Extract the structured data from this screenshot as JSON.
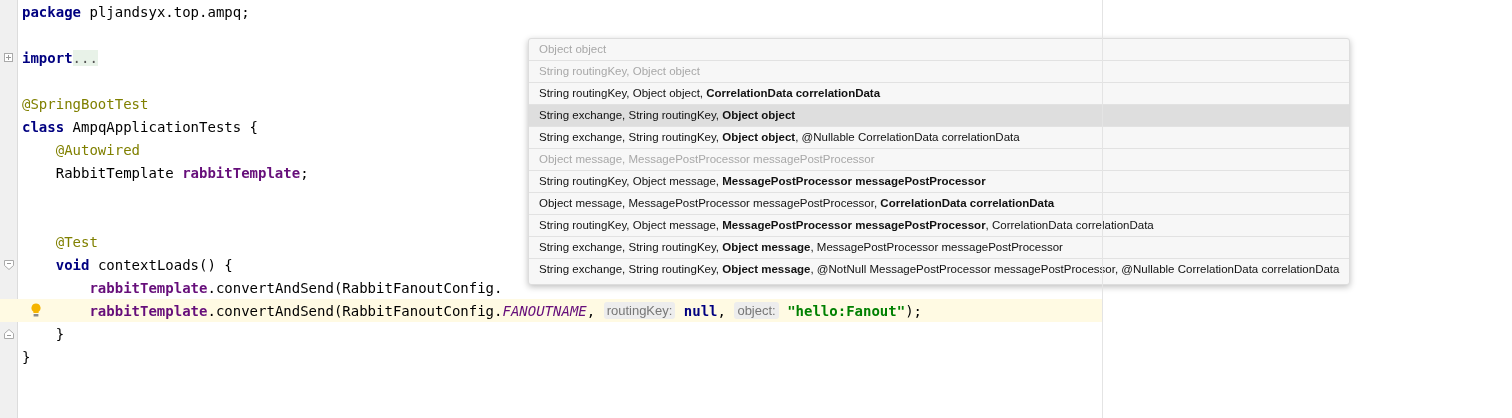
{
  "editor": {
    "lines": [
      {
        "current": false,
        "tokens": [
          {
            "kind": "keyword",
            "text": "package"
          },
          {
            "kind": "plain",
            "text": " pljandsyx.top.ampq;"
          }
        ]
      },
      {
        "current": false
      },
      {
        "current": false,
        "gutter": {
          "kind": "fold-plus"
        },
        "tokens": [
          {
            "kind": "keyword",
            "text": "import"
          },
          {
            "kind": "folded",
            "text": "..."
          }
        ]
      },
      {
        "current": false
      },
      {
        "current": false,
        "tokens": [
          {
            "kind": "annotation",
            "text": "@SpringBootTest"
          }
        ]
      },
      {
        "current": false,
        "tokens": [
          {
            "kind": "keyword",
            "text": "class"
          },
          {
            "kind": "plain",
            "text": " AmpqApplicationTests {"
          }
        ]
      },
      {
        "current": false,
        "tokens": [
          {
            "kind": "annotation",
            "text": "    @Autowired"
          }
        ]
      },
      {
        "current": false,
        "tokens": [
          {
            "kind": "plain",
            "text": "    RabbitTemplate "
          },
          {
            "kind": "field",
            "text": "rabbitTemplate"
          },
          {
            "kind": "plain",
            "text": ";"
          }
        ]
      },
      {
        "current": false
      },
      {
        "current": false
      },
      {
        "current": false,
        "tokens": [
          {
            "kind": "annotation",
            "text": "    @Test"
          }
        ]
      },
      {
        "current": false,
        "gutter": {
          "kind": "fold-minus"
        },
        "tokens": [
          {
            "kind": "keyword",
            "text": "    void"
          },
          {
            "kind": "plain",
            "text": " contextLoads() {"
          }
        ]
      },
      {
        "current": false,
        "tokens": [
          {
            "kind": "field",
            "text": "        rabbitTemplate"
          },
          {
            "kind": "plain",
            "text": ".convertAndSend(RabbitFanoutConfig."
          }
        ]
      },
      {
        "current": true,
        "gutter": {
          "kind": "bulb"
        },
        "tokens": [
          {
            "kind": "field",
            "text": "        rabbitTemplate"
          },
          {
            "kind": "plain",
            "text": ".convertAndSend(RabbitFanoutConfig."
          },
          {
            "kind": "static-field",
            "text": "FANOUTNAME"
          },
          {
            "kind": "plain",
            "text": ", "
          },
          {
            "kind": "hint",
            "text": "routingKey:"
          },
          {
            "kind": "keyword",
            "text": " null"
          },
          {
            "kind": "plain",
            "text": ", "
          },
          {
            "kind": "hint",
            "text": "object:"
          },
          {
            "kind": "string",
            "text": " \"hello:Fanout\""
          },
          {
            "kind": "plain",
            "text": ");"
          }
        ]
      },
      {
        "current": false,
        "gutter": {
          "kind": "fold-end"
        },
        "tokens": [
          {
            "kind": "plain",
            "text": "    }"
          }
        ]
      },
      {
        "current": false,
        "tokens": [
          {
            "kind": "plain",
            "text": "}"
          }
        ]
      }
    ]
  },
  "parameter_info": {
    "items": [
      {
        "text": "Object object",
        "disabled": true,
        "selected": false
      },
      {
        "text": "String routingKey, Object object",
        "disabled": true,
        "selected": false
      },
      {
        "text": "String routingKey, Object object, **CorrelationData correlationData**",
        "disabled": false,
        "selected": false
      },
      {
        "text": "String exchange, String routingKey, **Object object**",
        "disabled": false,
        "selected": true
      },
      {
        "text": "String exchange, String routingKey, **Object object**, @Nullable CorrelationData correlationData",
        "disabled": false,
        "selected": false
      },
      {
        "text": "Object message, MessagePostProcessor messagePostProcessor",
        "disabled": true,
        "selected": false
      },
      {
        "text": "String routingKey, Object message, **MessagePostProcessor messagePostProcessor**",
        "disabled": false,
        "selected": false
      },
      {
        "text": "Object message, MessagePostProcessor messagePostProcessor, **CorrelationData correlationData**",
        "disabled": false,
        "selected": false
      },
      {
        "text": "String routingKey, Object message, **MessagePostProcessor messagePostProcessor**, CorrelationData correlationData",
        "disabled": false,
        "selected": false
      },
      {
        "text": "String exchange, String routingKey, **Object message**, MessagePostProcessor messagePostProcessor",
        "disabled": false,
        "selected": false
      },
      {
        "text": "String exchange, String routingKey, **Object message**, @NotNull MessagePostProcessor messagePostProcessor, @Nullable CorrelationData correlationData",
        "disabled": false,
        "selected": false
      }
    ]
  }
}
